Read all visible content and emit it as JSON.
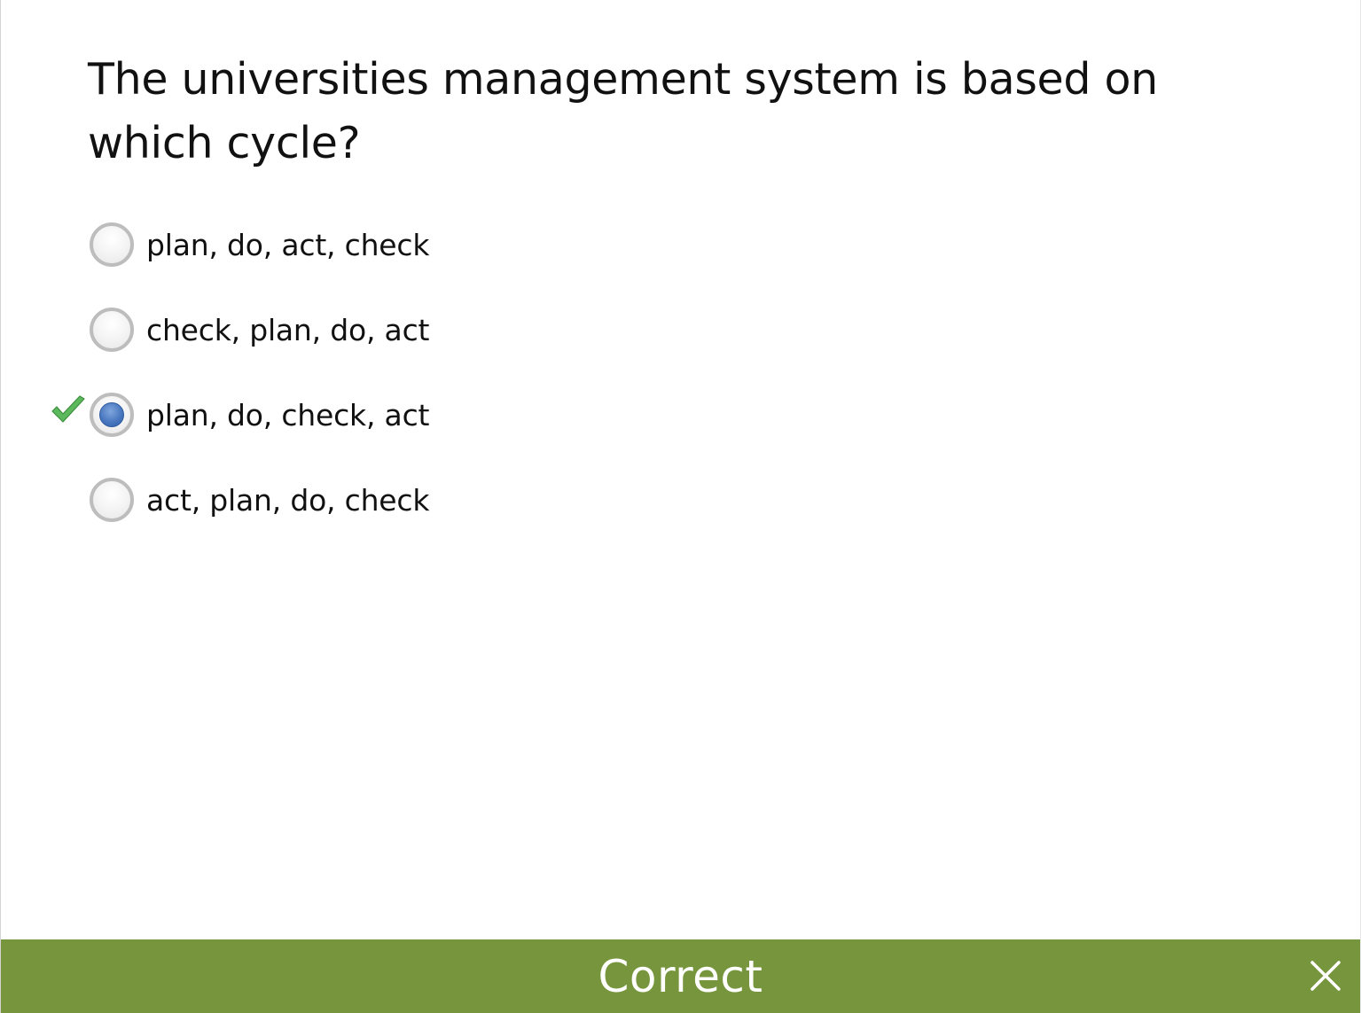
{
  "question": {
    "text": "The universities management system is based on which cycle?"
  },
  "options": [
    {
      "label": "plan, do, act, check",
      "selected": false,
      "correct": false
    },
    {
      "label": "check, plan, do, act",
      "selected": false,
      "correct": false
    },
    {
      "label": "plan, do, check, act",
      "selected": true,
      "correct": true
    },
    {
      "label": "act, plan, do, check",
      "selected": false,
      "correct": false
    }
  ],
  "feedback": {
    "text": "Correct",
    "color": "#77953d"
  },
  "icons": {
    "correct_marker": "checkmark-icon",
    "close": "close-icon"
  },
  "colors": {
    "radio_selected": "#4a78c0",
    "check_green": "#5cb85c"
  }
}
